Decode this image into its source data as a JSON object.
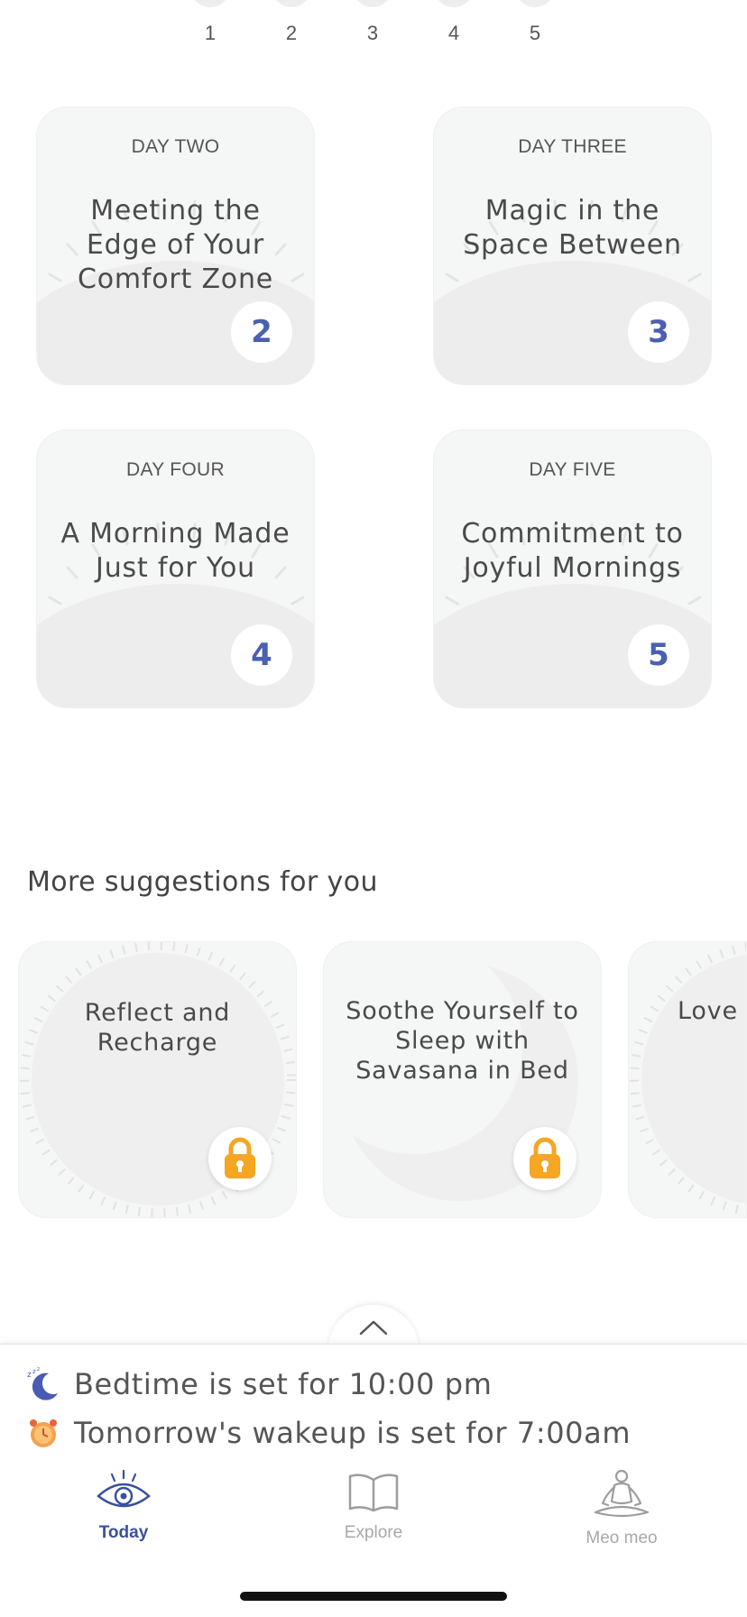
{
  "day_progress": [
    "1",
    "2",
    "3",
    "4",
    "5"
  ],
  "day_cards": [
    {
      "eyebrow": "DAY TWO",
      "title": "Meeting the Edge of Your Comfort Zone",
      "badge": "2"
    },
    {
      "eyebrow": "DAY THREE",
      "title": "Magic in the Space Between",
      "badge": "3"
    },
    {
      "eyebrow": "DAY FOUR",
      "title": "A Morning Made Just for You",
      "badge": "4"
    },
    {
      "eyebrow": "DAY FIVE",
      "title": "Commitment to Joyful Mornings",
      "badge": "5"
    }
  ],
  "suggestions": {
    "heading": "More suggestions for you",
    "items": [
      {
        "title": "Reflect and Recharge",
        "icon": "lock-icon"
      },
      {
        "title": "Soothe Yourself to Sleep with Savasana in Bed",
        "icon": "lock-icon"
      },
      {
        "title": "Love I"
      }
    ]
  },
  "schedule": {
    "bedtime": "Bedtime is set for 10:00 pm",
    "wakeup": "Tomorrow's wakeup is set for 7:00am"
  },
  "tabs": [
    {
      "label": "Today",
      "icon": "eye-icon",
      "active": true
    },
    {
      "label": "Explore",
      "icon": "book-icon",
      "active": false
    },
    {
      "label": "Meo meo",
      "icon": "meditation-icon",
      "active": false
    }
  ],
  "colors": {
    "accent": "#3a4f9e",
    "badge_number": "#4a60b0",
    "lock": "#f5a623",
    "card_bg": "#f5f6f6",
    "inactive_tab": "#a8a8a8"
  }
}
